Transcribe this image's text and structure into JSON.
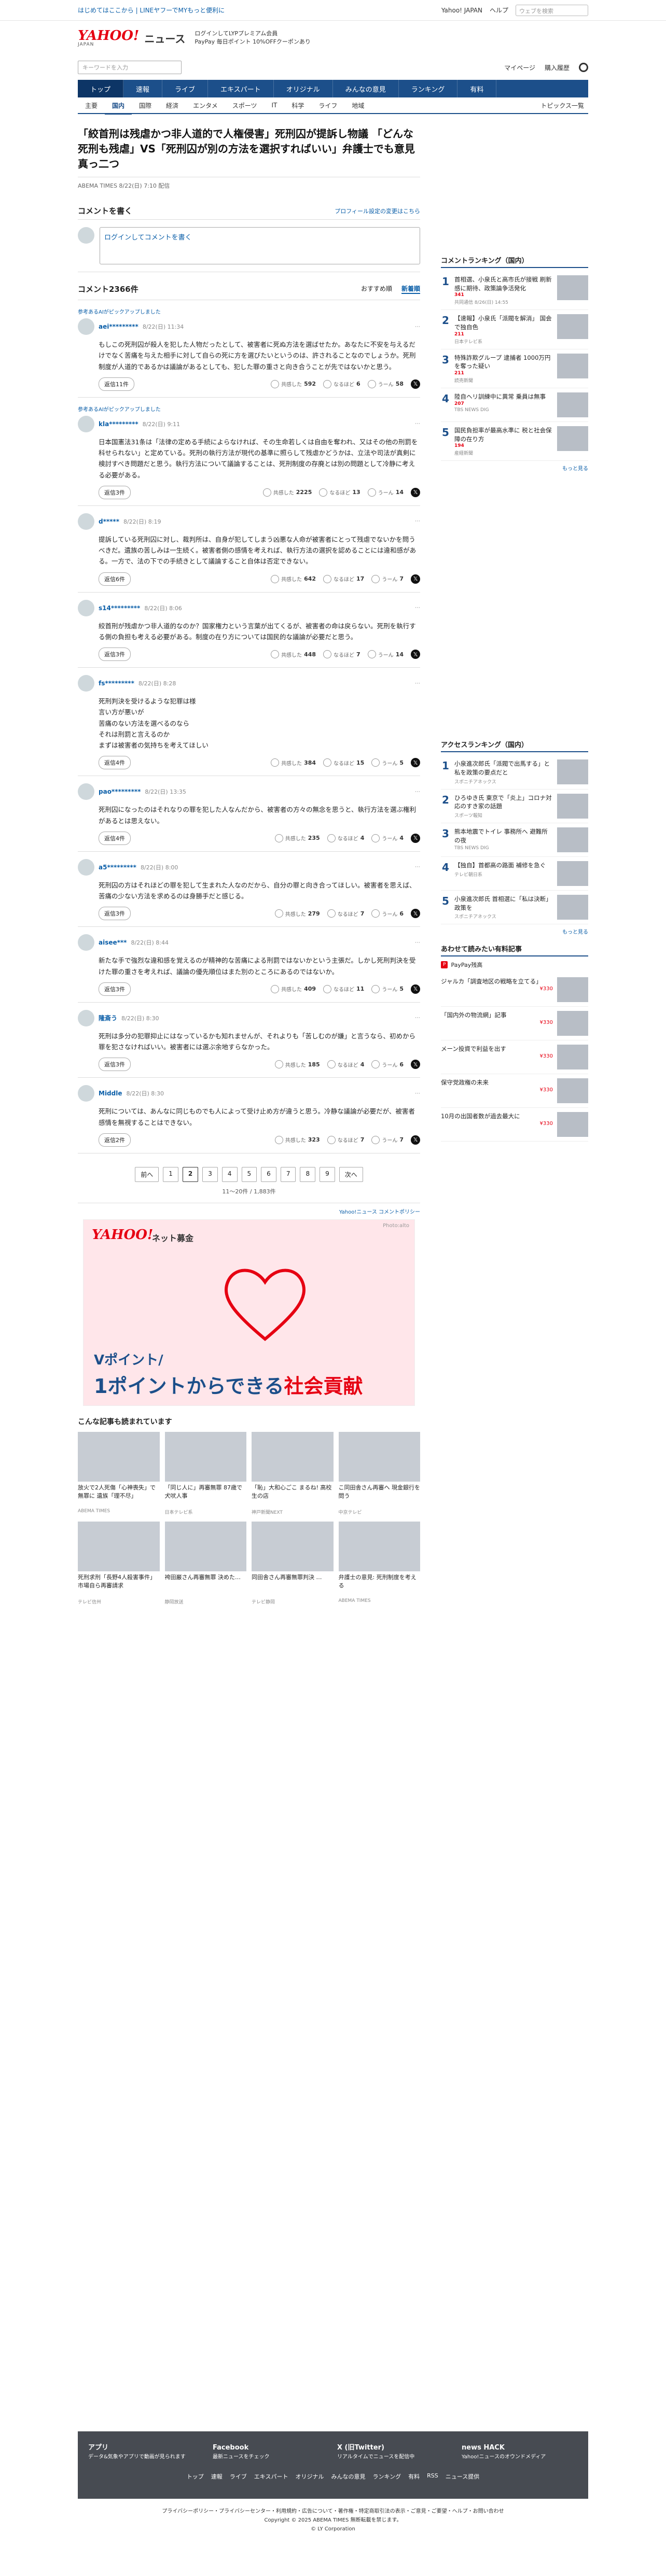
{
  "topstrip": {
    "links": "はじめてはここから | LINEヤフーでMYもっと便利に",
    "right": [
      "Yahoo! JAPAN",
      "ヘルプ"
    ],
    "search_placeholder": "ウェブを検索"
  },
  "header": {
    "logo": "YAHOO!",
    "logo_sub": "JAPAN",
    "service": "ニュース",
    "promo_line1": "ログインしてLYPプレミアム会員",
    "promo_line2": "PayPay 毎日ポイント 10%OFFクーポンあり"
  },
  "search": {
    "placeholder": "キーワードを入力",
    "right": [
      "マイページ",
      "購入履歴"
    ]
  },
  "mainnav": [
    "トップ",
    "速報",
    "ライブ",
    "エキスパート",
    "オリジナル",
    "みんなの意見",
    "ランキング",
    "有料"
  ],
  "subnav": [
    "主要",
    "国内",
    "国際",
    "経済",
    "エンタメ",
    "スポーツ",
    "IT",
    "科学",
    "ライフ",
    "地域"
  ],
  "subnav_right": "トピックス一覧",
  "article": {
    "title": "「絞首刑は残虐かつ非人道的で人権侵害」死刑囚が提訴し物議 「どんな死刑も残虐」VS「死刑囚が別の方法を選択すればいい」弁護士でも意見真っ二つ",
    "meta": "ABEMA TIMES 8/22(日) 7:10 配信"
  },
  "comments": {
    "heading": "コメントを書く",
    "profile_link": "プロフィール設定の変更はこちら",
    "input_placeholder": "ログインしてコメントを書く",
    "count": "コメント2366件",
    "sort": [
      "おすすめ順",
      "新着順"
    ],
    "reply_label": "返信",
    "react_labels": [
      "共感した",
      "なるほど",
      "うーん"
    ],
    "items": [
      {
        "label": "参考あるAIがピックアップしました",
        "user": "aei*********",
        "time": "8/22(日) 11:34",
        "body": "もしこの死刑囚が殺人を犯した人物だったとして、被害者に死ぬ方法を選ばせたか。あなたに不安を与えるだけでなく苦痛を与えた相手に対して自らの死に方を選びたいというのは、許されることなのでしょうか。死刑制度が人道的であるかは議論があるとしても、犯した罪の重さと向き合うことが先ではないかと思う。",
        "replies": "返信11件",
        "r": [
          592,
          6,
          58
        ]
      },
      {
        "label": "参考あるAIがピックアップしました",
        "user": "kla*********",
        "time": "8/22(日) 9:11",
        "body": "日本国憲法31条は「法律の定める手続によらなければ、その生命若しくは自由を奪われ、又はその他の刑罰を科せられない」と定めている。死刑の執行方法が現代の基準に照らして残虐かどうかは、立法や司法が真剣に検討すべき問題だと思う。執行方法について議論することは、死刑制度の存廃とは別の問題として冷静に考える必要がある。",
        "replies": "返信3件",
        "r": [
          2225,
          13,
          14
        ]
      },
      {
        "label": "",
        "user": "d*****",
        "time": "8/22(日) 8:19",
        "body": "提訴している死刑囚に対し、裁判所は、自身が犯してしまう凶悪な人命が被害者にとって残虐でないかを問うべきだ。遺族の苦しみは一生続く。被害者側の感情を考えれば、執行方法の選択を認めることには違和感がある。一方で、法の下での手続きとして議論すること自体は否定できない。",
        "replies": "返信6件",
        "r": [
          642,
          17,
          7
        ]
      },
      {
        "label": "",
        "user": "s14*********",
        "time": "8/22(日) 8:06",
        "body": "絞首刑が残虐かつ非人道的なのか？国家権力という言葉が出てくるが、被害者の命は戻らない。死刑を執行する側の負担も考える必要がある。制度の在り方については国民的な議論が必要だと思う。",
        "replies": "返信3件",
        "r": [
          448,
          7,
          14
        ]
      },
      {
        "label": "",
        "user": "fs*********",
        "time": "8/22(日) 8:28",
        "body": "死刑判決を受けるような犯罪は様\n言い方が悪いが\n苦痛のない方法を選べるのなら\nそれは刑罰と言えるのか\nまずは被害者の気持ちを考えてほしい",
        "replies": "返信4件",
        "r": [
          384,
          15,
          5
        ]
      },
      {
        "label": "",
        "user": "pao*********",
        "time": "8/22(日) 13:35",
        "body": "死刑囚になったのはそれなりの罪を犯した人なんだから、被害者の方々の無念を思うと、執行方法を選ぶ権利があるとは思えない。",
        "replies": "返信4件",
        "r": [
          235,
          4,
          4
        ]
      },
      {
        "label": "",
        "user": "a5*********",
        "time": "8/22(日) 8:00",
        "body": "死刑囚の方はそれほどの罪を犯して生まれた人なのだから、自分の罪と向き合ってほしい。被害者を思えば、苦痛の少ない方法を求めるのは身勝手だと感じる。",
        "replies": "返信3件",
        "r": [
          279,
          7,
          6
        ]
      },
      {
        "label": "",
        "user": "aisee***",
        "time": "8/22(日) 8:44",
        "body": "新たな手で強烈な違和感を覚えるのが精神的な苦痛による刑罰ではないかという主張だ。しかし死刑判決を受けた罪の重さを考えれば、議論の優先順位はまた別のところにあるのではないか。",
        "replies": "返信3件",
        "r": [
          409,
          11,
          5
        ]
      },
      {
        "label": "",
        "user": "隆斎う",
        "time": "8/22(日) 8:30",
        "body": "死刑は多分の犯罪抑止にはなっているかも知れませんが、それよりも「苦しむのが嫌」と言うなら、初めから罪を犯さなければいい。被害者には選ぶ余地すらなかった。",
        "replies": "返信3件",
        "r": [
          185,
          4,
          6
        ]
      },
      {
        "label": "",
        "user": "Middle",
        "time": "8/22(日) 8:30",
        "body": "死刑については、あんなに同じものでも人によって受け止め方が違うと思う。冷静な議論が必要だが、被害者感情を無視することはできない。",
        "replies": "返信2件",
        "r": [
          323,
          7,
          7
        ]
      }
    ]
  },
  "pager": {
    "prev": "前へ",
    "pages": [
      "1",
      "2",
      "3",
      "4",
      "5",
      "6",
      "7",
      "8",
      "9"
    ],
    "current": "2",
    "next": "次へ",
    "count": "11〜20件 / 1,883件"
  },
  "ad": {
    "link": "Yahoo!ニュース コメントポリシー",
    "logo": "YAHOO!",
    "tag": "ネット募金",
    "photo": "Photo:alto",
    "line1": "Vポイント/",
    "line2a": "1ポイントからできる",
    "line2b": "社会貢献"
  },
  "recommend": {
    "title": "こんな記事も読まれています",
    "items": [
      {
        "title": "放火で2人死傷「心神喪失」で無罪に 遺族「理不尽」",
        "source": "ABEMA TIMES"
      },
      {
        "title": "「同じ人に」再審無罪 87歳で犬吠人事",
        "source": "日本テレビ系"
      },
      {
        "title": "「恥」大和心ごこ まるね! 高校生の店",
        "source": "神戸新聞NEXT"
      },
      {
        "title": "こ同田舎さん再審へ 現金銀行を問う",
        "source": "中京テレビ"
      },
      {
        "title": "死刑求刑「長野4人殺害事件」市場自ら再審請求",
        "source": "テレビ信州"
      },
      {
        "title": "袴田巌さん再審無罪 決めた…",
        "source": "静岡放送"
      },
      {
        "title": "同田舎さん再審無罪判決 …",
        "source": "テレビ静岡"
      },
      {
        "title": "弁護士の意見: 死刑制度を考える",
        "source": "ABEMA TIMES"
      }
    ]
  },
  "sidebar": {
    "ranking_title": "コメントランキング（国内）",
    "ranking": [
      {
        "no": "1",
        "title": "首相選、小泉氏と高市氏が接戦 刷新感に期待、政策論争活発化",
        "count": "341",
        "source": "共同通信 8/26(日) 14:55"
      },
      {
        "no": "2",
        "title": "【速報】小泉氏「派閥を解消」 国会で独自色",
        "count": "211",
        "source": "日本テレビ系"
      },
      {
        "no": "3",
        "title": "特殊詐欺グループ 逮捕者 1000万円を奪った疑い",
        "count": "211",
        "source": "読売新聞"
      },
      {
        "no": "4",
        "title": "陸自ヘリ訓練中に異常 乗員は無事",
        "count": "207",
        "source": "TBS NEWS DIG"
      },
      {
        "no": "5",
        "title": "国民負担率が最高水準に 税と社会保障の在り方",
        "count": "194",
        "source": "産経新聞"
      }
    ],
    "more": "もっと見る",
    "access_title": "アクセスランキング（国内）",
    "access": [
      {
        "no": "1",
        "title": "小泉進次郎氏「派閥で出馬する」と私を政策の要点だと",
        "source": "スポニチアネックス"
      },
      {
        "no": "2",
        "title": "ひろゆき氏 東京で「炎上」コロナ対応のすき家の話題",
        "source": "スポーツ報知"
      },
      {
        "no": "3",
        "title": "熊本地震でトイレ 事務所へ 避難所の夜",
        "source": "TBS NEWS DIG"
      },
      {
        "no": "4",
        "title": "【独自】首都高の路面 補修を急ぐ",
        "source": "テレビ朝日系"
      },
      {
        "no": "5",
        "title": "小泉進次郎氏 首相選に「私は決断」政策を",
        "source": "スポニチアネックス"
      }
    ],
    "shopping_title": "あわせて読みたい有料記事",
    "paypay": "PayPay残高",
    "shopping": [
      {
        "title": "ジャルカ「調査地区の戦略を立てる」",
        "price": "¥330"
      },
      {
        "title": "「国内外の物流網」記事",
        "price": "¥330"
      },
      {
        "title": "メーン投資で利益を出す",
        "price": "¥330"
      },
      {
        "title": "保守党政権の未来",
        "price": "¥330"
      },
      {
        "title": "10月の出国者数が過去最大に",
        "price": "¥330"
      }
    ]
  },
  "footer": {
    "cols": [
      {
        "title": "アプリ",
        "text": "データ&気象やアプリで動画が見られます"
      },
      {
        "title": "Facebook",
        "text": "最新ニュースをチェック"
      },
      {
        "title": "X (旧Twitter)",
        "text": "リアルタイムでニュースを配信中"
      },
      {
        "title": "news HACK",
        "text": "Yahoo!ニュースのオウンドメディア"
      }
    ],
    "links": [
      "トップ",
      "速報",
      "ライブ",
      "エキスパート",
      "オリジナル",
      "みんなの意見",
      "ランキング",
      "有料",
      "RSS",
      "ニュース提供"
    ],
    "privacy": "プライバシーポリシー・プライバシーセンター・利用規約・広告について・著作権・特定商取引法の表示・ご意見・ご要望・ヘルプ・お問い合わせ",
    "copyright": "Copyright © 2025 ABEMA TIMES 無断転載を禁じます。",
    "corp": "© LY Corporation"
  },
  "colors": {
    "accent": "#1c4f8a",
    "brand_red": "#e60012",
    "link": "#0a5ea8"
  }
}
